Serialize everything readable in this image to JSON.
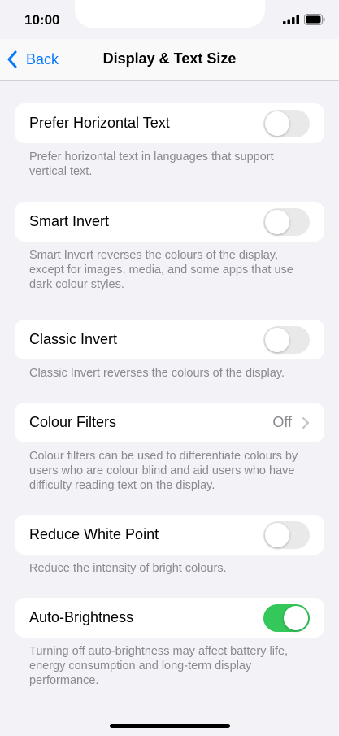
{
  "status_bar": {
    "time": "10:00"
  },
  "nav": {
    "back_label": "Back",
    "title": "Display & Text Size"
  },
  "colors": {
    "accent": "#0a7aff",
    "toggle_on": "#34c759",
    "toggle_off": "#e9e9ea",
    "background": "#f2f2f7"
  },
  "icons": {
    "back": "chevron-left-icon",
    "disclosure": "chevron-right-icon"
  },
  "settings": [
    {
      "label": "Prefer Horizontal Text",
      "footer": "Prefer horizontal text in languages that support vertical text.",
      "toggle_on": false
    },
    {
      "label": "Smart Invert",
      "footer": "Smart Invert reverses the colours of the display, except for images, media, and some apps that use dark colour styles.",
      "toggle_on": false
    },
    {
      "label": "Classic Invert",
      "footer": "Classic Invert reverses the colours of the display.",
      "toggle_on": false
    },
    {
      "label": "Colour Filters",
      "value": "Off",
      "footer": "Colour filters can be used to differentiate colours by users who are colour blind and aid users who have difficulty reading text on the display."
    },
    {
      "label": "Reduce White Point",
      "footer": "Reduce the intensity of bright colours.",
      "toggle_on": false
    },
    {
      "label": "Auto-Brightness",
      "footer": "Turning off auto-brightness may affect battery life, energy consumption and long-term display performance.",
      "toggle_on": true
    }
  ]
}
